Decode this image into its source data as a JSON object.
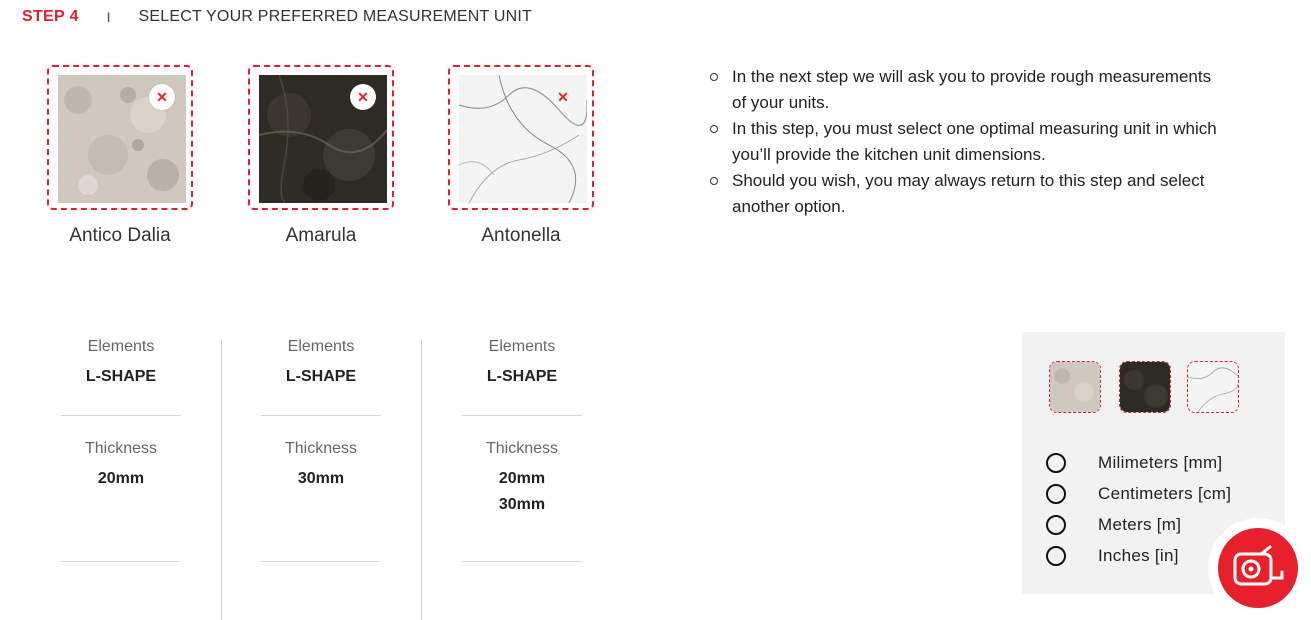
{
  "step": {
    "label": "STEP 4",
    "separator": "I",
    "title": "SELECT YOUR PREFERRED MEASUREMENT UNIT"
  },
  "stones": [
    {
      "name": "Antico Dalia",
      "remove_icon": "close-icon"
    },
    {
      "name": "Amarula",
      "remove_icon": "close-icon"
    },
    {
      "name": "Antonella",
      "remove_icon": "close-icon"
    }
  ],
  "info": [
    "In the next step we will ask you to provide rough measurements of your units.",
    "In this step, you must select one optimal measuring unit in which you’ll provide the kitchen unit dimensions.",
    "Should you wish, you may always return to this step and select another option."
  ],
  "specs": [
    {
      "elements_label": "Elements",
      "elements_value": "L-SHAPE",
      "thickness_label": "Thickness",
      "thickness_values": [
        "20mm"
      ]
    },
    {
      "elements_label": "Elements",
      "elements_value": "L-SHAPE",
      "thickness_label": "Thickness",
      "thickness_values": [
        "30mm"
      ]
    },
    {
      "elements_label": "Elements",
      "elements_value": "L-SHAPE",
      "thickness_label": "Thickness",
      "thickness_values": [
        "20mm",
        "30mm"
      ]
    }
  ],
  "units": [
    {
      "label": "Milimeters [mm]",
      "selected": false
    },
    {
      "label": "Centimeters [cm]",
      "selected": false
    },
    {
      "label": "Meters [m]",
      "selected": false
    },
    {
      "label": "Inches [in]",
      "selected": false
    }
  ],
  "colors": {
    "accent": "#e0202f",
    "panel": "#f2f2f2"
  },
  "fab": {
    "icon": "measuring-tape-icon"
  }
}
